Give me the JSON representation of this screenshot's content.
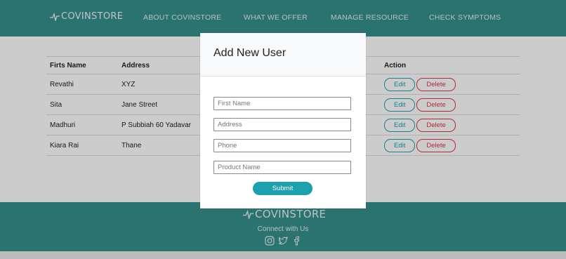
{
  "nav": {
    "logo": "COVINSTORE",
    "links": [
      "ABOUT COVINSTORE",
      "WHAT WE OFFER",
      "MANAGE RESOURCE",
      "CHECK SYMPTOMS"
    ]
  },
  "table": {
    "headers": [
      "Firts Name",
      "Address",
      "Action"
    ],
    "rows": [
      {
        "first_name": "Revathi",
        "address": "XYZ"
      },
      {
        "first_name": "Sita",
        "address": "Jane Street"
      },
      {
        "first_name": "Madhuri",
        "address": "P Subbiah 60 Yadavar"
      },
      {
        "first_name": "Kiara Rai",
        "address": "Thane"
      }
    ],
    "edit_label": "Edit",
    "delete_label": "Delete"
  },
  "footer": {
    "logo": "COVINSTORE",
    "connect": "Connect with Us",
    "socials": [
      "instagram-icon",
      "twitter-icon",
      "facebook-icon"
    ]
  },
  "modal": {
    "title": "Add New User",
    "fields": {
      "first_name": {
        "placeholder": "First Name",
        "value": ""
      },
      "address": {
        "placeholder": "Address",
        "value": ""
      },
      "phone": {
        "placeholder": "Phone",
        "value": ""
      },
      "product_name": {
        "placeholder": "Product Name",
        "value": ""
      }
    },
    "submit_label": "Submit"
  },
  "colors": {
    "brand": "#36908e",
    "submit": "#1ba0ad",
    "edit": "#17a2b8",
    "delete": "#dc3545"
  }
}
